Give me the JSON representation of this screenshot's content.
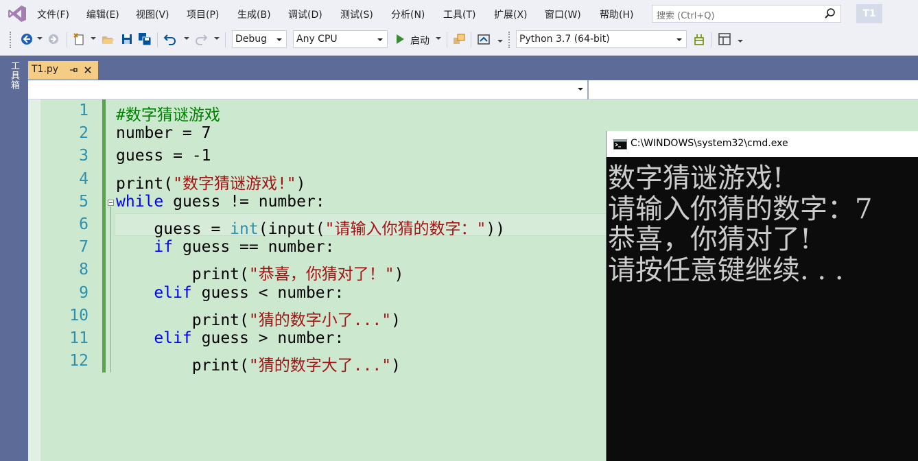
{
  "menu": {
    "items": [
      "文件(F)",
      "编辑(E)",
      "视图(V)",
      "项目(P)",
      "生成(B)",
      "调试(D)",
      "测试(S)",
      "分析(N)",
      "工具(T)",
      "扩展(X)",
      "窗口(W)",
      "帮助(H)"
    ],
    "search_placeholder": "搜索 (Ctrl+Q)",
    "project_badge": "T1"
  },
  "toolbar": {
    "config": "Debug",
    "platform": "Any CPU",
    "start_label": "启动",
    "environment": "Python 3.7 (64-bit)"
  },
  "toolbox_label": "工具箱",
  "tab": {
    "title": "T1.py"
  },
  "editor": {
    "line_numbers": [
      "1",
      "2",
      "3",
      "4",
      "5",
      "6",
      "7",
      "8",
      "9",
      "10",
      "11",
      "12"
    ],
    "lines": [
      [
        {
          "t": "#数字猜谜游戏",
          "c": "cm"
        }
      ],
      [
        {
          "t": "number = 7",
          "c": ""
        }
      ],
      [
        {
          "t": "guess = -1",
          "c": ""
        }
      ],
      [
        {
          "t": "print(",
          "c": ""
        },
        {
          "t": "\"数字猜谜游戏!\"",
          "c": "str"
        },
        {
          "t": ")",
          "c": ""
        }
      ],
      [
        {
          "t": "while",
          "c": "kw"
        },
        {
          "t": " guess != number:",
          "c": ""
        }
      ],
      [
        {
          "t": "    guess = ",
          "c": ""
        },
        {
          "t": "int",
          "c": "ty"
        },
        {
          "t": "(input(",
          "c": ""
        },
        {
          "t": "\"请输入你猜的数字：\"",
          "c": "str"
        },
        {
          "t": "))",
          "c": ""
        }
      ],
      [
        {
          "t": "    ",
          "c": ""
        },
        {
          "t": "if",
          "c": "kw"
        },
        {
          "t": " guess == number:",
          "c": ""
        }
      ],
      [
        {
          "t": "        print(",
          "c": ""
        },
        {
          "t": "\"恭喜，你猜对了！\"",
          "c": "str"
        },
        {
          "t": ")",
          "c": ""
        }
      ],
      [
        {
          "t": "    ",
          "c": ""
        },
        {
          "t": "elif",
          "c": "kw"
        },
        {
          "t": " guess < number:",
          "c": ""
        }
      ],
      [
        {
          "t": "        print(",
          "c": ""
        },
        {
          "t": "\"猜的数字小了...\"",
          "c": "str"
        },
        {
          "t": ")",
          "c": ""
        }
      ],
      [
        {
          "t": "    ",
          "c": ""
        },
        {
          "t": "elif",
          "c": "kw"
        },
        {
          "t": " guess > number:",
          "c": ""
        }
      ],
      [
        {
          "t": "        print(",
          "c": ""
        },
        {
          "t": "\"猜的数字大了...\"",
          "c": "str"
        },
        {
          "t": ")",
          "c": ""
        }
      ]
    ]
  },
  "console": {
    "title": "C:\\WINDOWS\\system32\\cmd.exe",
    "lines": [
      "数字猜谜游戏!",
      "请输入你猜的数字：7",
      "恭喜，你猜对了!",
      "请按任意键继续. . ."
    ]
  },
  "colors": {
    "accent_tab": "#f5cc84",
    "frame": "#5d6b99",
    "editor_bg": "#cce8cf",
    "line_number": "#2b91af",
    "keyword": "#0000ff",
    "comment": "#008000",
    "string": "#a31515"
  }
}
